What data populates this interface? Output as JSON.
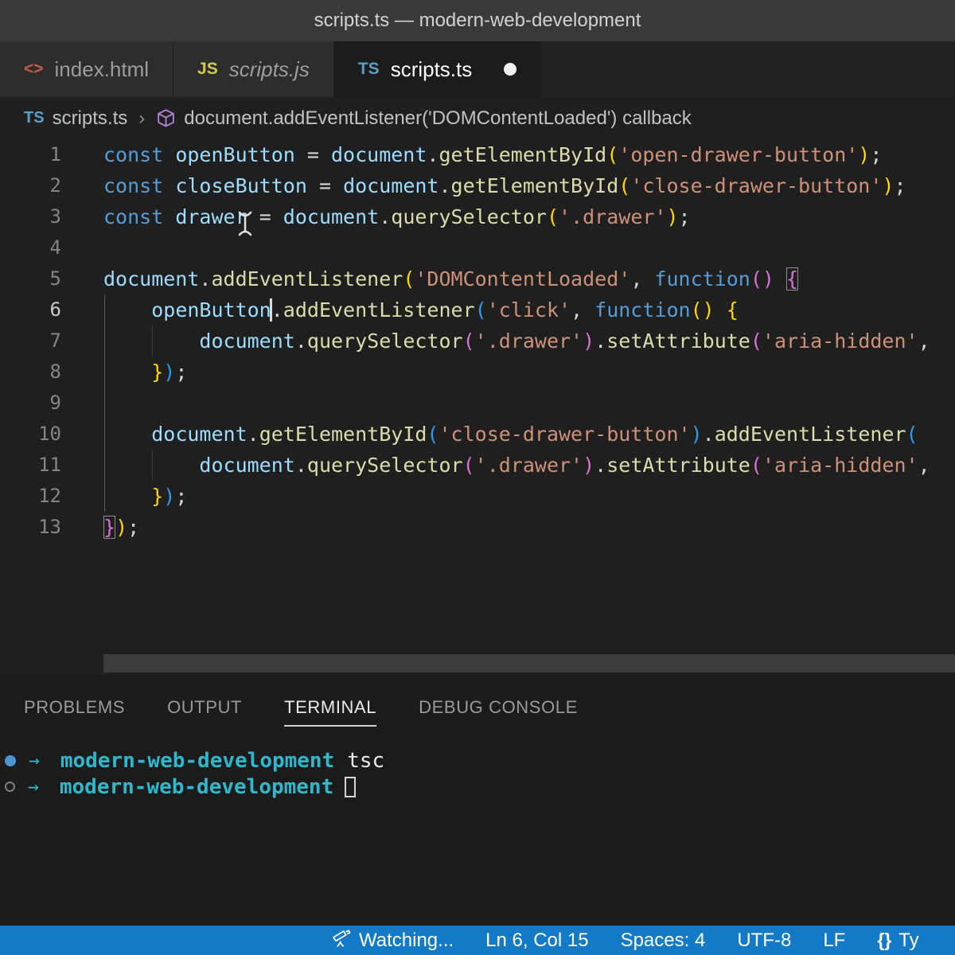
{
  "window": {
    "title": "scripts.ts — modern-web-development"
  },
  "tabs": [
    {
      "name": "tab-index-html",
      "icon": "html",
      "icon_text": "<>",
      "label": "index.html",
      "active": false,
      "modified": false,
      "italic": false
    },
    {
      "name": "tab-scripts-js",
      "icon": "js",
      "icon_text": "JS",
      "label": "scripts.js",
      "active": false,
      "modified": false,
      "italic": true
    },
    {
      "name": "tab-scripts-ts",
      "icon": "ts",
      "icon_text": "TS",
      "label": "scripts.ts",
      "active": true,
      "modified": true,
      "italic": false
    }
  ],
  "breadcrumb": {
    "file_icon_text": "TS",
    "file_label": "scripts.ts",
    "separator": "›",
    "symbol_label": "document.addEventListener('DOMContentLoaded') callback"
  },
  "editor": {
    "active_line": 6,
    "lines": [
      {
        "num": 1,
        "guides": [],
        "tokens": [
          [
            "kw",
            "const"
          ],
          [
            "op",
            " "
          ],
          [
            "var",
            "openButton"
          ],
          [
            "op",
            " = "
          ],
          [
            "var",
            "document"
          ],
          [
            "op",
            "."
          ],
          [
            "fn",
            "getElementById"
          ],
          [
            "b1",
            "("
          ],
          [
            "str",
            "'open-drawer-button'"
          ],
          [
            "b1",
            ")"
          ],
          [
            "op",
            ";"
          ]
        ]
      },
      {
        "num": 2,
        "guides": [],
        "tokens": [
          [
            "kw",
            "const"
          ],
          [
            "op",
            " "
          ],
          [
            "var",
            "closeButton"
          ],
          [
            "op",
            " = "
          ],
          [
            "var",
            "document"
          ],
          [
            "op",
            "."
          ],
          [
            "fn",
            "getElementById"
          ],
          [
            "b1",
            "("
          ],
          [
            "str",
            "'close-drawer-button'"
          ],
          [
            "b1",
            ")"
          ],
          [
            "op",
            ";"
          ]
        ]
      },
      {
        "num": 3,
        "guides": [],
        "tokens": [
          [
            "kw",
            "const"
          ],
          [
            "op",
            " "
          ],
          [
            "var",
            "drawer"
          ],
          [
            "op",
            " = "
          ],
          [
            "var",
            "document"
          ],
          [
            "op",
            "."
          ],
          [
            "fn",
            "querySelector"
          ],
          [
            "b1",
            "("
          ],
          [
            "str",
            "'.drawer'"
          ],
          [
            "b1",
            ")"
          ],
          [
            "op",
            ";"
          ]
        ]
      },
      {
        "num": 4,
        "guides": [],
        "tokens": []
      },
      {
        "num": 5,
        "guides": [],
        "tokens": [
          [
            "var",
            "document"
          ],
          [
            "op",
            "."
          ],
          [
            "fn",
            "addEventListener"
          ],
          [
            "b1",
            "("
          ],
          [
            "str",
            "'DOMContentLoaded'"
          ],
          [
            "op",
            ", "
          ],
          [
            "kw",
            "function"
          ],
          [
            "b2",
            "()"
          ],
          [
            "op",
            " "
          ],
          [
            "b2x",
            "{"
          ]
        ]
      },
      {
        "num": 6,
        "guides": [
          0
        ],
        "tokens": [
          [
            "ws",
            "    "
          ],
          [
            "var",
            "openButton"
          ],
          [
            "caret",
            ""
          ],
          [
            "op",
            "."
          ],
          [
            "fn",
            "addEventListener"
          ],
          [
            "b3",
            "("
          ],
          [
            "str",
            "'click'"
          ],
          [
            "op",
            ", "
          ],
          [
            "kw",
            "function"
          ],
          [
            "b1",
            "()"
          ],
          [
            "op",
            " "
          ],
          [
            "b1",
            "{"
          ]
        ]
      },
      {
        "num": 7,
        "guides": [
          0,
          1
        ],
        "tokens": [
          [
            "ws",
            "        "
          ],
          [
            "var",
            "document"
          ],
          [
            "op",
            "."
          ],
          [
            "fn",
            "querySelector"
          ],
          [
            "b2",
            "("
          ],
          [
            "str",
            "'.drawer'"
          ],
          [
            "b2",
            ")"
          ],
          [
            "op",
            "."
          ],
          [
            "fn",
            "setAttribute"
          ],
          [
            "b2",
            "("
          ],
          [
            "str",
            "'aria-hidden'"
          ],
          [
            "op",
            ","
          ]
        ]
      },
      {
        "num": 8,
        "guides": [
          0
        ],
        "tokens": [
          [
            "ws",
            "    "
          ],
          [
            "b1",
            "}"
          ],
          [
            "b3",
            ")"
          ],
          [
            "op",
            ";"
          ]
        ]
      },
      {
        "num": 9,
        "guides": [
          0
        ],
        "tokens": []
      },
      {
        "num": 10,
        "guides": [
          0
        ],
        "tokens": [
          [
            "ws",
            "    "
          ],
          [
            "var",
            "document"
          ],
          [
            "op",
            "."
          ],
          [
            "fn",
            "getElementById"
          ],
          [
            "b3",
            "("
          ],
          [
            "str",
            "'close-drawer-button'"
          ],
          [
            "b3",
            ")"
          ],
          [
            "op",
            "."
          ],
          [
            "fn",
            "addEventListener"
          ],
          [
            "b3",
            "("
          ]
        ]
      },
      {
        "num": 11,
        "guides": [
          0,
          1
        ],
        "tokens": [
          [
            "ws",
            "        "
          ],
          [
            "var",
            "document"
          ],
          [
            "op",
            "."
          ],
          [
            "fn",
            "querySelector"
          ],
          [
            "b2",
            "("
          ],
          [
            "str",
            "'.drawer'"
          ],
          [
            "b2",
            ")"
          ],
          [
            "op",
            "."
          ],
          [
            "fn",
            "setAttribute"
          ],
          [
            "b2",
            "("
          ],
          [
            "str",
            "'aria-hidden'"
          ],
          [
            "op",
            ","
          ]
        ]
      },
      {
        "num": 12,
        "guides": [
          0
        ],
        "tokens": [
          [
            "ws",
            "    "
          ],
          [
            "b1",
            "}"
          ],
          [
            "b3",
            ")"
          ],
          [
            "op",
            ";"
          ]
        ]
      },
      {
        "num": 13,
        "guides": [],
        "tokens": [
          [
            "b2x",
            "}"
          ],
          [
            "b1",
            ")"
          ],
          [
            "op",
            ";"
          ]
        ]
      }
    ]
  },
  "panel": {
    "tabs": [
      {
        "name": "panel-tab-problems",
        "label": "PROBLEMS",
        "active": false
      },
      {
        "name": "panel-tab-output",
        "label": "OUTPUT",
        "active": false
      },
      {
        "name": "panel-tab-terminal",
        "label": "TERMINAL",
        "active": true
      },
      {
        "name": "panel-tab-debug-console",
        "label": "DEBUG CONSOLE",
        "active": false
      }
    ],
    "terminal_rows": [
      {
        "decoration": "filled",
        "arrow": "→",
        "dir": "modern-web-development",
        "command": "tsc",
        "cursor": false
      },
      {
        "decoration": "outline",
        "arrow": "→",
        "dir": "modern-web-development",
        "command": "",
        "cursor": true
      }
    ]
  },
  "status_bar": {
    "items": [
      {
        "name": "status-watching",
        "icon": "telescope",
        "label": "Watching..."
      },
      {
        "name": "status-cursor-position",
        "label": "Ln 6, Col 15"
      },
      {
        "name": "status-indentation",
        "label": "Spaces: 4"
      },
      {
        "name": "status-encoding",
        "label": "UTF-8"
      },
      {
        "name": "status-eol",
        "label": "LF"
      },
      {
        "name": "status-language",
        "icon_text": "{}",
        "label": "Ty"
      }
    ]
  },
  "colors": {
    "status_bar_bg": "#127ac6",
    "editor_bg": "#1f1f1f",
    "keyword": "#569cd6",
    "variable": "#9cdcfe",
    "function": "#dcdcaa",
    "string": "#ce9178",
    "bracket_gold": "#ffd700",
    "bracket_orchid": "#da70d6",
    "bracket_blue": "#2e9cec",
    "terminal_cyan": "#2fb8cc",
    "ts_icon_blue": "#5b9fc9",
    "js_icon_yellow": "#d2c94f",
    "html_icon_orange": "#c15d49"
  }
}
